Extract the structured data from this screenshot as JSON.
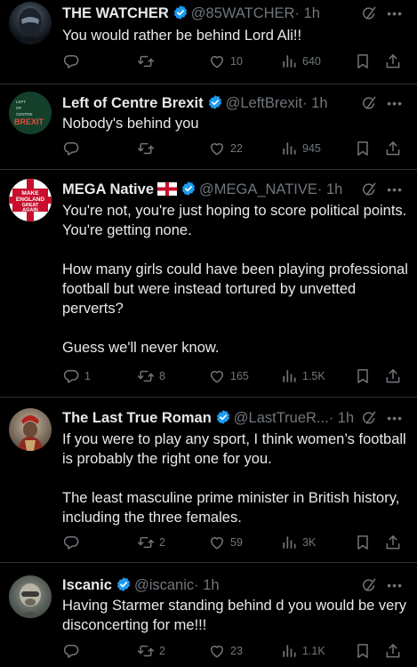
{
  "tweets": [
    {
      "name": "THE WATCHER",
      "handle": "@85WATCHER",
      "time": "· 1h",
      "text": [
        "You would rather be behind Lord Ali!!"
      ],
      "replies": "",
      "reposts": "",
      "likes": "10",
      "views": "640"
    },
    {
      "name": "Left of Centre Brexit",
      "handle": "@LeftBrexit",
      "time": "· 1h",
      "avatar_text": [
        "LEFT",
        "OF",
        "CENTRE",
        "BREXIT"
      ],
      "text": [
        "Nobody's behind you"
      ],
      "replies": "",
      "reposts": "",
      "likes": "22",
      "views": "945"
    },
    {
      "name": "MEGA Native",
      "handle": "@MEGA_NATIVE",
      "time": "· 1h",
      "avatar_text": [
        "MAKE",
        "ENGLAND",
        "GREAT",
        "AGAIN"
      ],
      "text": [
        "You're not, you're just hoping to score political points. You're getting none.",
        "How many girls could have been playing professional football but were instead tortured by unvetted perverts?",
        "Guess we'll never know."
      ],
      "replies": "1",
      "reposts": "8",
      "likes": "165",
      "views": "1.5K"
    },
    {
      "name": "The Last True Roman",
      "handle": "@LastTrueR...",
      "time": "· 1h",
      "text": [
        "If you were to play any sport, I think women’s football is probably the right one for you.",
        "The least masculine prime minister in British history, including the three females."
      ],
      "replies": "",
      "reposts": "2",
      "likes": "59",
      "views": "3K"
    },
    {
      "name": "Iscanic",
      "handle": "@iscanic",
      "time": "· 1h",
      "text": [
        "Having Starmer standing behind d you would be very disconcerting for me!!!"
      ],
      "replies": "",
      "reposts": "2",
      "likes": "23",
      "views": "1.1K"
    }
  ],
  "colors": {
    "background": "#000000",
    "text": "#e7e9ea",
    "muted": "#71767b",
    "verified": "#1d9bf0",
    "divider": "#2f3336"
  },
  "icons": [
    "reply-icon",
    "repost-icon",
    "like-icon",
    "views-icon",
    "bookmark-icon",
    "share-icon",
    "grok-icon",
    "more-icon",
    "verified-icon",
    "england-flag-icon"
  ]
}
